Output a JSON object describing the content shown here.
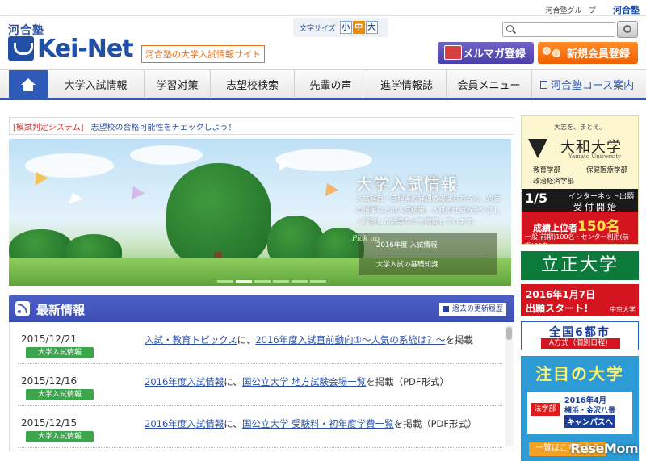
{
  "topbar": {
    "group_label": "河合塾グループ",
    "group_logo": "河合塾"
  },
  "header": {
    "logo_small": "河合塾",
    "logo_main": "Kei-Net",
    "tagline": "河合塾の大学入試情報サイト",
    "fontsize_label": "文字サイズ",
    "fontsize_options": [
      "小",
      "中",
      "大"
    ],
    "fontsize_selected": "中",
    "search_icon": "search-icon",
    "mail_button": "メルマガ登録",
    "register_button": "新規会員登録"
  },
  "nav": {
    "home_icon": "home-icon",
    "items": [
      "大学入試情報",
      "学習対策",
      "志望校検索",
      "先輩の声",
      "進学情報誌",
      "会員メニュー",
      "河合塾コース案内"
    ]
  },
  "notice": {
    "tag": "[模試判定システム]",
    "text": "志望校の合格可能性をチェックしよう！"
  },
  "hero": {
    "title": "大学入試情報",
    "desc": "入試科目・日程等の詳細情報はもちろん、過去の倍率などの入試結果、入試の仕組みをやさしく解説した記事などを掲載しています。",
    "pickup_label": "Pick up",
    "pickup_items": [
      "2016年度 入試情報",
      "大学入試の基礎知識"
    ]
  },
  "news": {
    "title": "最新情報",
    "archive_link": "過去の更新履歴",
    "items": [
      {
        "date": "2015/12/21",
        "tag": "大学入試情報",
        "link1": "入試・教育トピックス",
        "mid": "に、",
        "link2": "2016年度入試直前動向①～人気の系統は？～",
        "suffix": "を掲載"
      },
      {
        "date": "2015/12/16",
        "tag": "大学入試情報",
        "link1": "2016年度入試情報",
        "mid": "に、",
        "link2": "国公立大学 地方試験会場一覧",
        "suffix": "を掲載（PDF形式）"
      },
      {
        "date": "2015/12/15",
        "tag": "大学入試情報",
        "link1": "2016年度入試情報",
        "mid": "に、",
        "link2": "国公立大学 受験料・初年度学費一覧",
        "suffix": "を掲載（PDF形式）"
      }
    ]
  },
  "ads": {
    "yamato": {
      "catch": "大志を、まとえ。",
      "name": "大和大学",
      "en": "Yamato University",
      "faculties": [
        "教育学部",
        "保健医療学部",
        "政治経済学部"
      ],
      "date": "1/5",
      "inet": "インターネット出願",
      "recv": "受付開始",
      "rank_prefix": "成績上位者",
      "rank_num": "150名",
      "rank_note": "一般(前期)100名・センター利用(前期)50名"
    },
    "rissho": "立正大学",
    "chukyo": {
      "line1": "2016年1月7日",
      "line2": "出願スタート!",
      "logo": "中京大学"
    },
    "toshi": {
      "line1": "全国6都市",
      "line2": "A方式（個別日程）"
    },
    "chumoku": {
      "title": "注目の大学",
      "faculty": "法学部",
      "info1": "2016年4月",
      "info2": "横浜・金沢八景",
      "info3": "キャンパスへ",
      "list_button": "一覧はこちらから"
    }
  },
  "watermark": "ReseMom"
}
